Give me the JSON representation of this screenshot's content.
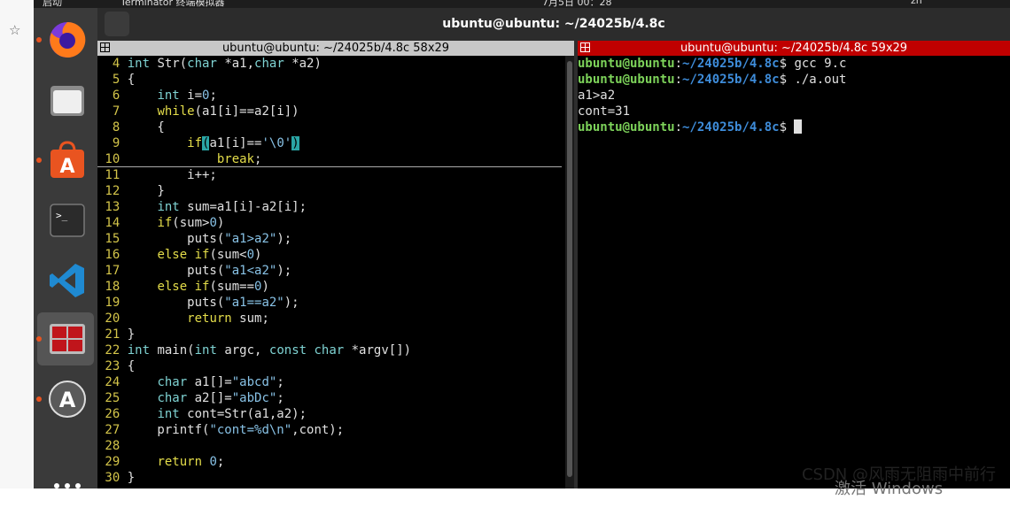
{
  "system_bar": {
    "left_text": "启动",
    "app_text": "Terminator 终端模拟器",
    "date_text": "7月5日 00：28",
    "right_text": "zh"
  },
  "window": {
    "title": "ubuntu@ubuntu: ~/24025b/4.8c"
  },
  "dock": {
    "items": [
      {
        "name": "firefox"
      },
      {
        "name": "files"
      },
      {
        "name": "ubuntu-software"
      },
      {
        "name": "terminal"
      },
      {
        "name": "vscode"
      },
      {
        "name": "terminator"
      },
      {
        "name": "software-updater"
      },
      {
        "name": "show-apps"
      }
    ]
  },
  "left_pane": {
    "title": "ubuntu@ubuntu: ~/24025b/4.8c 58x29",
    "lines": [
      [
        {
          "c": "ln",
          "t": "  4 "
        },
        {
          "c": "ty",
          "t": "int"
        },
        {
          "c": "ident",
          "t": " Str("
        },
        {
          "c": "ty",
          "t": "char"
        },
        {
          "c": "ident",
          "t": " *a1,"
        },
        {
          "c": "ty",
          "t": "char"
        },
        {
          "c": "ident",
          "t": " *a2)"
        }
      ],
      [
        {
          "c": "ln",
          "t": "  5 "
        },
        {
          "c": "ident",
          "t": "{"
        }
      ],
      [
        {
          "c": "ln",
          "t": "  6 "
        },
        {
          "c": "ident",
          "t": "    "
        },
        {
          "c": "ty",
          "t": "int"
        },
        {
          "c": "ident",
          "t": " i="
        },
        {
          "c": "nm",
          "t": "0"
        },
        {
          "c": "ident",
          "t": ";"
        }
      ],
      [
        {
          "c": "ln",
          "t": "  7 "
        },
        {
          "c": "ident",
          "t": "    "
        },
        {
          "c": "kw",
          "t": "while"
        },
        {
          "c": "ident",
          "t": "(a1[i]==a2[i])"
        }
      ],
      [
        {
          "c": "ln",
          "t": "  8 "
        },
        {
          "c": "ident",
          "t": "    {"
        }
      ],
      [
        {
          "c": "ln",
          "t": "  9 "
        },
        {
          "c": "ident",
          "t": "        "
        },
        {
          "c": "kw",
          "t": "if"
        },
        {
          "c": "hl",
          "t": "("
        },
        {
          "c": "ident",
          "t": "a1[i]=="
        },
        {
          "c": "st",
          "t": "'\\0'"
        },
        {
          "c": "hl",
          "t": ")"
        }
      ],
      [
        {
          "c": "ln",
          "t": " 10 "
        },
        {
          "c": "ident",
          "t": "            "
        },
        {
          "c": "kw",
          "t": "break"
        },
        {
          "c": "ident",
          "t": ";"
        }
      ],
      [
        {
          "c": "ln",
          "t": " 11 "
        },
        {
          "c": "ident",
          "t": "        i++;"
        }
      ],
      [
        {
          "c": "ln",
          "t": " 12 "
        },
        {
          "c": "ident",
          "t": "    }"
        }
      ],
      [
        {
          "c": "ln",
          "t": " 13 "
        },
        {
          "c": "ident",
          "t": "    "
        },
        {
          "c": "ty",
          "t": "int"
        },
        {
          "c": "ident",
          "t": " sum=a1[i]-a2[i];"
        }
      ],
      [
        {
          "c": "ln",
          "t": " 14 "
        },
        {
          "c": "ident",
          "t": "    "
        },
        {
          "c": "kw",
          "t": "if"
        },
        {
          "c": "ident",
          "t": "(sum>"
        },
        {
          "c": "nm",
          "t": "0"
        },
        {
          "c": "ident",
          "t": ")"
        }
      ],
      [
        {
          "c": "ln",
          "t": " 15 "
        },
        {
          "c": "ident",
          "t": "        puts("
        },
        {
          "c": "st",
          "t": "\"a1>a2\""
        },
        {
          "c": "ident",
          "t": ");"
        }
      ],
      [
        {
          "c": "ln",
          "t": " 16 "
        },
        {
          "c": "ident",
          "t": "    "
        },
        {
          "c": "kw",
          "t": "else if"
        },
        {
          "c": "ident",
          "t": "(sum<"
        },
        {
          "c": "nm",
          "t": "0"
        },
        {
          "c": "ident",
          "t": ")"
        }
      ],
      [
        {
          "c": "ln",
          "t": " 17 "
        },
        {
          "c": "ident",
          "t": "        puts("
        },
        {
          "c": "st",
          "t": "\"a1<a2\""
        },
        {
          "c": "ident",
          "t": ");"
        }
      ],
      [
        {
          "c": "ln",
          "t": " 18 "
        },
        {
          "c": "ident",
          "t": "    "
        },
        {
          "c": "kw",
          "t": "else if"
        },
        {
          "c": "ident",
          "t": "(sum=="
        },
        {
          "c": "nm",
          "t": "0"
        },
        {
          "c": "ident",
          "t": ")"
        }
      ],
      [
        {
          "c": "ln",
          "t": " 19 "
        },
        {
          "c": "ident",
          "t": "        puts("
        },
        {
          "c": "st",
          "t": "\"a1==a2\""
        },
        {
          "c": "ident",
          "t": ");"
        }
      ],
      [
        {
          "c": "ln",
          "t": " 20 "
        },
        {
          "c": "ident",
          "t": "        "
        },
        {
          "c": "kw",
          "t": "return"
        },
        {
          "c": "ident",
          "t": " sum;"
        }
      ],
      [
        {
          "c": "ln",
          "t": " 21 "
        },
        {
          "c": "ident",
          "t": "}"
        }
      ],
      [
        {
          "c": "ln",
          "t": " 22 "
        },
        {
          "c": "ty",
          "t": "int"
        },
        {
          "c": "ident",
          "t": " main("
        },
        {
          "c": "ty",
          "t": "int"
        },
        {
          "c": "ident",
          "t": " argc, "
        },
        {
          "c": "ty",
          "t": "const char"
        },
        {
          "c": "ident",
          "t": " *argv[])"
        }
      ],
      [
        {
          "c": "ln",
          "t": " 23 "
        },
        {
          "c": "ident",
          "t": "{"
        }
      ],
      [
        {
          "c": "ln",
          "t": " 24 "
        },
        {
          "c": "ident",
          "t": "    "
        },
        {
          "c": "ty",
          "t": "char"
        },
        {
          "c": "ident",
          "t": " a1[]="
        },
        {
          "c": "st",
          "t": "\"abcd\""
        },
        {
          "c": "ident",
          "t": ";"
        }
      ],
      [
        {
          "c": "ln",
          "t": " 25 "
        },
        {
          "c": "ident",
          "t": "    "
        },
        {
          "c": "ty",
          "t": "char"
        },
        {
          "c": "ident",
          "t": " a2[]="
        },
        {
          "c": "st",
          "t": "\"abDc\""
        },
        {
          "c": "ident",
          "t": ";"
        }
      ],
      [
        {
          "c": "ln",
          "t": " 26 "
        },
        {
          "c": "ident",
          "t": "    "
        },
        {
          "c": "ty",
          "t": "int"
        },
        {
          "c": "ident",
          "t": " cont=Str(a1,a2);"
        }
      ],
      [
        {
          "c": "ln",
          "t": " 27 "
        },
        {
          "c": "ident",
          "t": "    printf("
        },
        {
          "c": "st",
          "t": "\"cont=%d\\n\""
        },
        {
          "c": "ident",
          "t": ",cont);"
        }
      ],
      [
        {
          "c": "ln",
          "t": " 28 "
        }
      ],
      [
        {
          "c": "ln",
          "t": " 29 "
        },
        {
          "c": "ident",
          "t": "    "
        },
        {
          "c": "kw",
          "t": "return"
        },
        {
          "c": "ident",
          "t": " "
        },
        {
          "c": "nm",
          "t": "0"
        },
        {
          "c": "ident",
          "t": ";"
        }
      ],
      [
        {
          "c": "ln",
          "t": " 30 "
        },
        {
          "c": "ident",
          "t": "}"
        }
      ]
    ]
  },
  "right_pane": {
    "title": "ubuntu@ubuntu: ~/24025b/4.8c 59x29",
    "lines": [
      {
        "prompt": {
          "user": "ubuntu@ubuntu",
          "colon": ":",
          "path": "~/24025b/4.8c",
          "sym": "$ "
        },
        "cmd": "gcc 9.c"
      },
      {
        "prompt": {
          "user": "ubuntu@ubuntu",
          "colon": ":",
          "path": "~/24025b/4.8c",
          "sym": "$ "
        },
        "cmd": "./a.out"
      },
      {
        "out": "a1>a2"
      },
      {
        "out": "cont=31"
      },
      {
        "prompt": {
          "user": "ubuntu@ubuntu",
          "colon": ":",
          "path": "~/24025b/4.8c",
          "sym": "$ "
        },
        "cmd": "",
        "cursor": true
      }
    ]
  },
  "watermark": "CSDN @风雨无阻雨中前行",
  "activate_text": "激活 Windows",
  "colors": {
    "terminator_split_active": "#c00000",
    "prompt_user": "#7dd35a",
    "prompt_path": "#3e8cd9",
    "dock_indicator": "#e95420"
  }
}
